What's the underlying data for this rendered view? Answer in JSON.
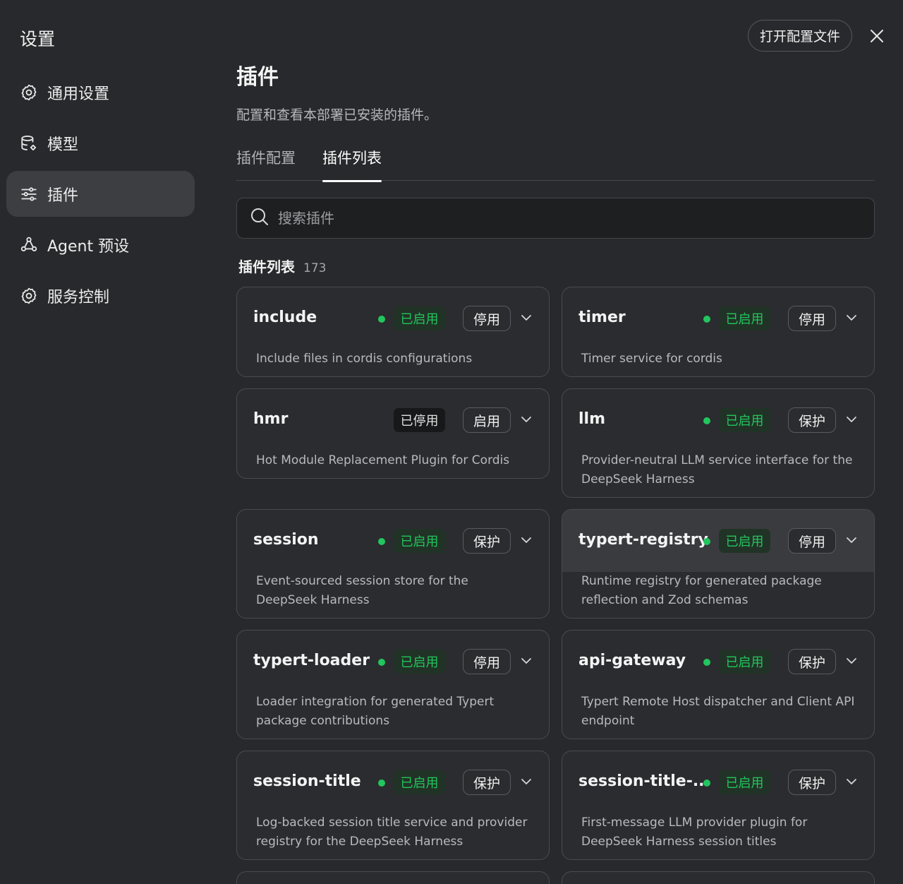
{
  "window": {
    "title": "设置"
  },
  "header": {
    "open_config_label": "打开配置文件"
  },
  "sidebar": {
    "items": [
      {
        "label": "通用设置",
        "icon": "gear-icon",
        "active": false
      },
      {
        "label": "模型",
        "icon": "database-gear-icon",
        "active": false
      },
      {
        "label": "插件",
        "icon": "sliders-icon",
        "active": true
      },
      {
        "label": "Agent 预设",
        "icon": "agent-icon",
        "active": false
      },
      {
        "label": "服务控制",
        "icon": "gear-icon",
        "active": false
      }
    ]
  },
  "main": {
    "title": "插件",
    "description": "配置和查看本部署已安装的插件。",
    "tabs": [
      {
        "label": "插件配置",
        "active": false
      },
      {
        "label": "插件列表",
        "active": true
      }
    ],
    "search": {
      "placeholder": "搜索插件"
    },
    "list": {
      "title": "插件列表",
      "count": "173"
    }
  },
  "colors": {
    "enabled": "#22c55e",
    "background": "#28292c",
    "card": "#2b2c2f"
  },
  "plugins": [
    {
      "name": "include",
      "status": "已启用",
      "enabled": true,
      "action": "停用",
      "desc": "Include files in cordis configurations"
    },
    {
      "name": "timer",
      "status": "已启用",
      "enabled": true,
      "action": "停用",
      "desc": "Timer service for cordis"
    },
    {
      "name": "hmr",
      "status": "已停用",
      "enabled": false,
      "action": "启用",
      "desc": "Hot Module Replacement Plugin for Cordis"
    },
    {
      "name": "llm",
      "status": "已启用",
      "enabled": true,
      "action": "保护",
      "desc": "Provider-neutral LLM service interface for the DeepSeek Harness"
    },
    {
      "name": "session",
      "status": "已启用",
      "enabled": true,
      "action": "保护",
      "desc": "Event-sourced session store for the DeepSeek Harness"
    },
    {
      "name": "typert-registry",
      "status": "已启用",
      "enabled": true,
      "action": "停用",
      "desc": "Runtime registry for generated package reflection and Zod schemas"
    },
    {
      "name": "typert-loader",
      "status": "已启用",
      "enabled": true,
      "action": "停用",
      "desc": "Loader integration for generated Typert package contributions"
    },
    {
      "name": "api-gateway",
      "status": "已启用",
      "enabled": true,
      "action": "保护",
      "desc": "Typert Remote Host dispatcher and Client API endpoint"
    },
    {
      "name": "session-title",
      "status": "已启用",
      "enabled": true,
      "action": "保护",
      "desc": "Log-backed session title service and provider registry for the DeepSeek Harness"
    },
    {
      "name": "session-title-...",
      "status": "已启用",
      "enabled": true,
      "action": "保护",
      "desc": "First-message LLM provider plugin for DeepSeek Harness session titles"
    }
  ]
}
